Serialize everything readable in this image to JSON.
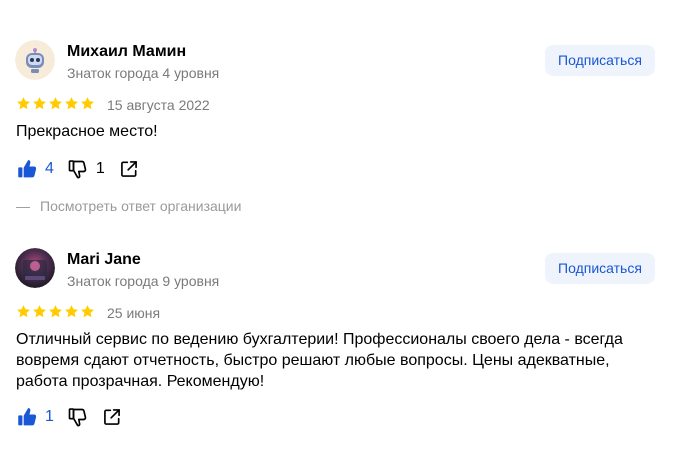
{
  "reviews": [
    {
      "author": "Михаил Мамин",
      "level": "Знаток города 4 уровня",
      "subscribe_label": "Подписаться",
      "rating": 5,
      "date": "15 августа 2022",
      "text": "Прекрасное место!",
      "likes": "4",
      "dislikes": "1",
      "org_reply_label": "Посмотреть ответ организации"
    },
    {
      "author": "Mari Jane",
      "level": "Знаток города 9 уровня",
      "subscribe_label": "Подписаться",
      "rating": 5,
      "date": "25 июня",
      "text": "Отличный сервис по ведению бухгалтерии! Профессионалы своего дела - всегда вовремя сдают отчетность, быстро решают любые вопросы. Цены адекватные, работа прозрачная. Рекомендую!",
      "likes": "1"
    }
  ],
  "icons": {
    "star": "star-icon",
    "like": "thumbs-up-icon",
    "dislike": "thumbs-down-icon",
    "share": "share-icon"
  },
  "colors": {
    "accent": "#1a57d6",
    "star": "#ffcc00",
    "muted": "#7a7a7a",
    "button_bg": "#eef3fc"
  }
}
